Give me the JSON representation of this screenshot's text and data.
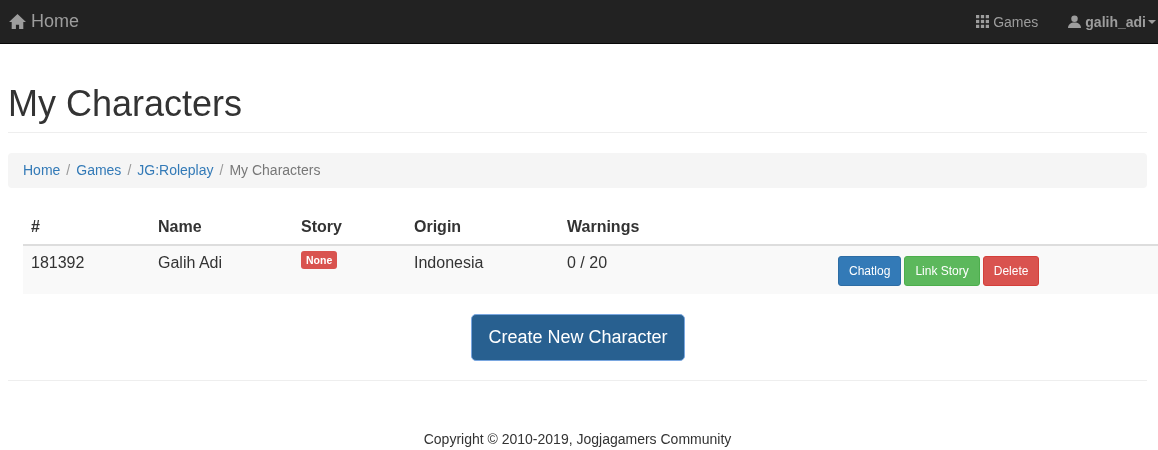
{
  "navbar": {
    "brand": "Home",
    "links": [
      {
        "label": "Games",
        "kind": "grid"
      },
      {
        "label": "galih_adi",
        "kind": "user"
      }
    ]
  },
  "page_title": "My Characters",
  "breadcrumb": [
    {
      "label": "Home",
      "current": false
    },
    {
      "separator": "/",
      "label": "Games",
      "current": false
    },
    {
      "separator": "/",
      "label": "JG:Roleplay",
      "current": false
    },
    {
      "separator": "/",
      "label": "My Characters",
      "current": true
    }
  ],
  "table": {
    "columns": [
      "#",
      "Name",
      "Story",
      "Origin",
      "Warnings"
    ],
    "rows": [
      {
        "id": "181392",
        "name": "Galih Adi",
        "story": "None",
        "origin": "Indonesia",
        "warnings": "0 / 20",
        "actions": [
          {
            "label": "Chatlog",
            "kind": "primary"
          },
          {
            "label": "Link Story",
            "kind": "success"
          },
          {
            "label": "Delete",
            "kind": "danger"
          }
        ]
      }
    ]
  },
  "create_button": "Create New Character",
  "footer": "Copyright © 2010-2019, Jogjagamers Community"
}
